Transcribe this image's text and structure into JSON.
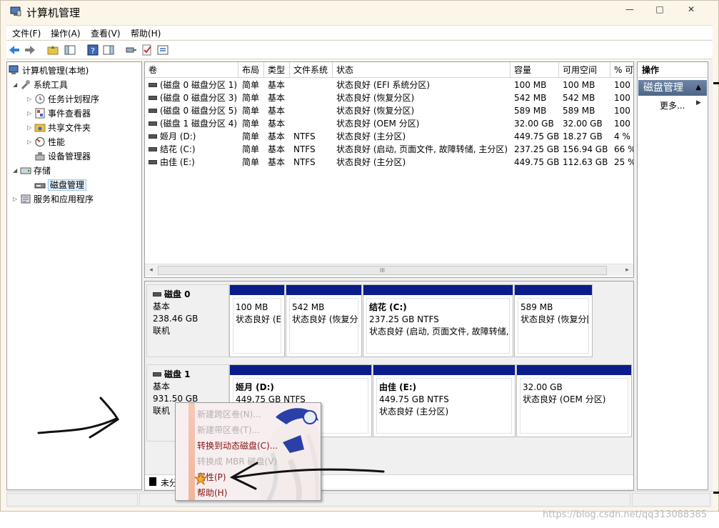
{
  "window": {
    "title": "计算机管理",
    "min": "—",
    "max": "□",
    "close": "✕"
  },
  "menu": [
    "文件(F)",
    "操作(A)",
    "查看(V)",
    "帮助(H)"
  ],
  "tree": {
    "root": "计算机管理(本地)",
    "system_tools": "系统工具",
    "task_scheduler": "任务计划程序",
    "event_viewer": "事件查看器",
    "shared_folders": "共享文件夹",
    "performance": "性能",
    "device_manager": "设备管理器",
    "storage": "存储",
    "disk_management": "磁盘管理",
    "services_apps": "服务和应用程序"
  },
  "volume_table": {
    "headers": [
      "卷",
      "布局",
      "类型",
      "文件系统",
      "状态",
      "容量",
      "可用空间",
      "% 可"
    ],
    "rows": [
      [
        "(磁盘 0 磁盘分区 1)",
        "简单",
        "基本",
        "",
        "状态良好 (EFI 系统分区)",
        "100 MB",
        "100 MB",
        "100"
      ],
      [
        "(磁盘 0 磁盘分区 3)",
        "简单",
        "基本",
        "",
        "状态良好 (恢复分区)",
        "542 MB",
        "542 MB",
        "100"
      ],
      [
        "(磁盘 0 磁盘分区 5)",
        "简单",
        "基本",
        "",
        "状态良好 (恢复分区)",
        "589 MB",
        "589 MB",
        "100"
      ],
      [
        "(磁盘 1 磁盘分区 4)",
        "简单",
        "基本",
        "",
        "状态良好 (OEM 分区)",
        "32.00 GB",
        "32.00 GB",
        "100"
      ],
      [
        "姬月 (D:)",
        "简单",
        "基本",
        "NTFS",
        "状态良好 (主分区)",
        "449.75 GB",
        "18.27 GB",
        "4 %"
      ],
      [
        "结花 (C:)",
        "简单",
        "基本",
        "NTFS",
        "状态良好 (启动, 页面文件, 故障转储, 主分区)",
        "237.25 GB",
        "156.94 GB",
        "66 %"
      ],
      [
        "由佳 (E:)",
        "简单",
        "基本",
        "NTFS",
        "状态良好 (主分区)",
        "449.75 GB",
        "112.63 GB",
        "25 %"
      ]
    ],
    "scroll_left": "◂",
    "scroll_right": "▸",
    "scroll_grip": "III"
  },
  "disks": [
    {
      "name": "磁盘 0",
      "type": "基本",
      "size": "238.46 GB",
      "status": "联机",
      "partitions": [
        {
          "name": "",
          "size": "100 MB",
          "status": "状态良好 (E"
        },
        {
          "name": "",
          "size": "542 MB",
          "status": "状态良好 (恢复分"
        },
        {
          "name": "结花  (C:)",
          "size": "237.25 GB NTFS",
          "status": "状态良好 (启动, 页面文件, 故障转储,"
        },
        {
          "name": "",
          "size": "589 MB",
          "status": "状态良好 (恢复分["
        }
      ]
    },
    {
      "name": "磁盘 1",
      "type": "基本",
      "size": "931.50 GB",
      "status": "联机",
      "partitions": [
        {
          "name": "姬月  (D:)",
          "size": "449.75 GB NTFS",
          "status": ""
        },
        {
          "name": "由佳  (E:)",
          "size": "449.75 GB NTFS",
          "status": "状态良好 (主分区)"
        },
        {
          "name": "",
          "size": "32.00 GB",
          "status": "状态良好 (OEM 分区)"
        }
      ]
    }
  ],
  "legend": {
    "unallocated": "未分"
  },
  "actions": {
    "header": "操作",
    "section": "磁盘管理",
    "more": "更多..."
  },
  "context_menu": {
    "items": [
      {
        "label": "新建跨区卷(N)...",
        "enabled": false
      },
      {
        "label": "新建带区卷(T)...",
        "enabled": false
      },
      {
        "label": "转换到动态磁盘(C)...",
        "enabled": true
      },
      {
        "label": "转换成 MBR 磁盘(V)",
        "enabled": false
      },
      {
        "label": "属性(P)",
        "enabled": true
      },
      {
        "label": "帮助(H)",
        "enabled": true
      }
    ]
  },
  "watermark": "https://blog.csdn.net/qq313088385",
  "colors": {
    "partition_bar": "#0a1d8a",
    "window_frame": "#fcf6ea",
    "action_section": "#5a7394"
  }
}
